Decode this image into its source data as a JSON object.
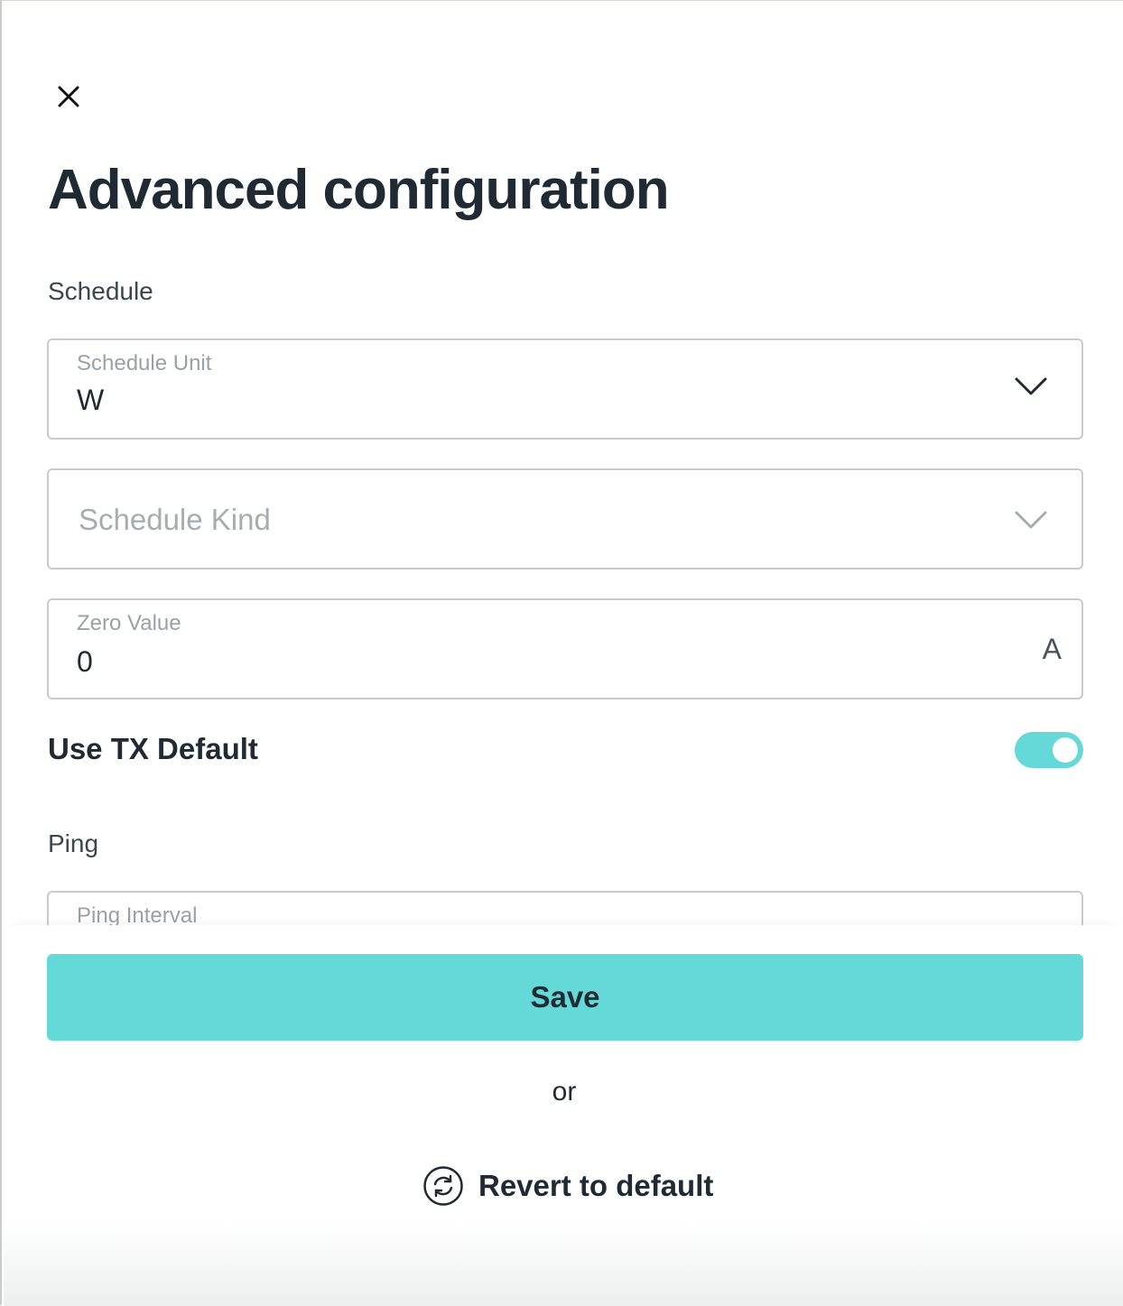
{
  "header": {
    "close_icon": "close-icon",
    "title": "Advanced configuration"
  },
  "schedule": {
    "section_label": "Schedule",
    "unit": {
      "label": "Schedule Unit",
      "value": "W",
      "icon": "chevron-down-icon"
    },
    "kind": {
      "placeholder": "Schedule Kind",
      "icon": "chevron-down-icon"
    },
    "zero_value": {
      "label": "Zero Value",
      "value": "0",
      "suffix": "A"
    },
    "use_tx_default": {
      "label": "Use TX Default",
      "enabled": true
    }
  },
  "ping": {
    "section_label": "Ping",
    "interval": {
      "label": "Ping Interval"
    }
  },
  "footer": {
    "save_label": "Save",
    "or_label": "or",
    "revert_label": "Revert to default",
    "revert_icon": "refresh-icon"
  },
  "colors": {
    "accent": "#65d9d7",
    "text": "#1f2a33",
    "muted": "#9aa1a6",
    "border": "#c8cbcd"
  }
}
